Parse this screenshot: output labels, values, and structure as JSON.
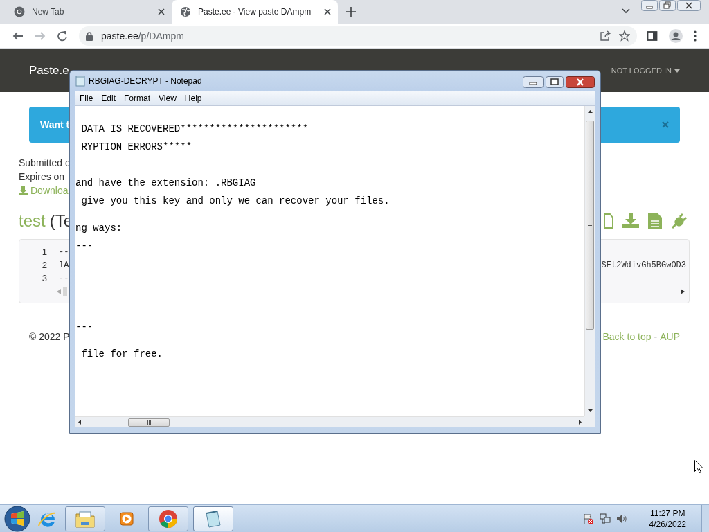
{
  "browser": {
    "tabs": [
      {
        "title": "New Tab",
        "kind": "newtab",
        "selected": false
      },
      {
        "title": "Paste.ee - View paste DAmpm",
        "kind": "site",
        "selected": true
      }
    ],
    "nav_buttons": [
      {
        "kind": "back",
        "disabled": false
      },
      {
        "kind": "forward",
        "disabled": true
      },
      {
        "kind": "reload",
        "disabled": false
      }
    ],
    "address": {
      "host": "paste.ee",
      "path": "/p/DAmpm"
    }
  },
  "page": {
    "brand": "Paste.e",
    "account_menu": "NOT LOGGED IN",
    "banner": "Want t",
    "meta": [
      "Submitted c",
      "Expires on"
    ],
    "download_link": "Downloa",
    "title": "test",
    "title_suffix": "(Te",
    "code_lines": [
      {
        "number": "1",
        "text": "--"
      },
      {
        "number": "2",
        "text": "lA",
        "tail": "SEt2WdivGh5BGwOD3"
      },
      {
        "number": "3",
        "text": "--"
      }
    ],
    "footer": {
      "copyright": "© 2022 P",
      "links": [
        "Back to top",
        "AUP"
      ],
      "separator": "-"
    }
  },
  "notepad": {
    "title": "RBGIAG-DECRYPT - Notepad",
    "menu": [
      "File",
      "Edit",
      "Format",
      "View",
      "Help"
    ],
    "lines": [
      " DATA IS RECOVERED**********************",
      " RYPTION ERRORS*****",
      "and have the extension: .RBGIAG",
      " give you this key and only we can recover your files.",
      "ng ways:",
      "---",
      "---",
      " file for free."
    ]
  },
  "taskbar": {
    "apps": [
      {
        "kind": "ie",
        "running": false,
        "active": false
      },
      {
        "kind": "explorer",
        "running": true,
        "active": false
      },
      {
        "kind": "media",
        "running": false,
        "active": false
      },
      {
        "kind": "chrome",
        "running": true,
        "active": false
      },
      {
        "kind": "notepad",
        "running": true,
        "active": true
      }
    ],
    "time": "11:27 PM",
    "date": "4/26/2022"
  }
}
